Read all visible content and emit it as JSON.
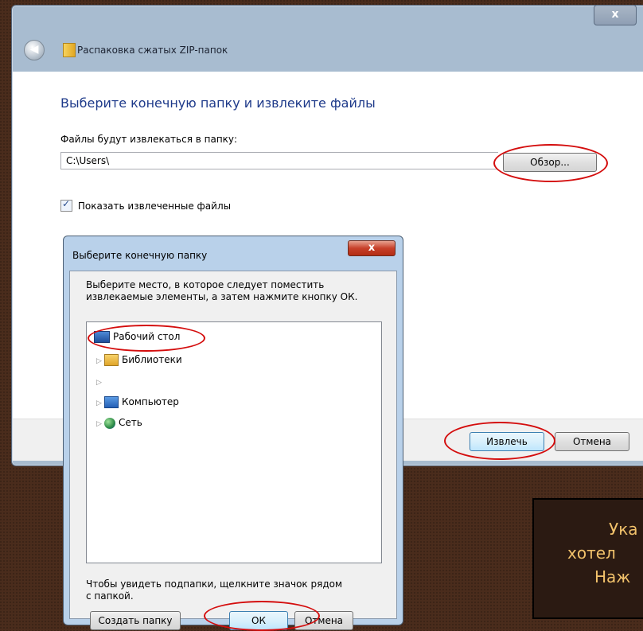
{
  "main_window": {
    "close_glyph": "x",
    "title": "Распаковка сжатых ZIP-папок",
    "heading": "Выберите конечную папку и извлеките файлы",
    "extract_label": "Файлы будут извлекаться в папку:",
    "path_value": "C:\\Users\\",
    "browse_label": "Обзор...",
    "show_files_label": "Показать извлеченные файлы",
    "show_files_checked": true,
    "extract_button": "Извлечь",
    "cancel_button": "Отмена"
  },
  "folder_dialog": {
    "title": "Выберите конечную папку",
    "close_glyph": "x",
    "instructions": "Выберите место, в которое следует поместить извлекаемые элементы, а затем нажмите кнопку ОК.",
    "tree": [
      {
        "label": "Рабочий стол",
        "icon": "desktop-icon"
      },
      {
        "label": "Библиотеки",
        "icon": "libraries-icon"
      },
      {
        "label": "",
        "icon": ""
      },
      {
        "label": "Компьютер",
        "icon": "computer-icon"
      },
      {
        "label": "Сеть",
        "icon": "network-icon"
      }
    ],
    "hint": "Чтобы увидеть подпапки, щелкните значок рядом с папкой.",
    "new_folder_button": "Создать папку",
    "ok_button": "ОК",
    "cancel_button": "Отмена"
  },
  "caption": {
    "line1": "Ука",
    "line2": "хотел",
    "line3": "Наж"
  },
  "colors": {
    "highlight": "#d40d0d",
    "heading": "#1e3a8a",
    "caption_text": "#f2c26b"
  }
}
